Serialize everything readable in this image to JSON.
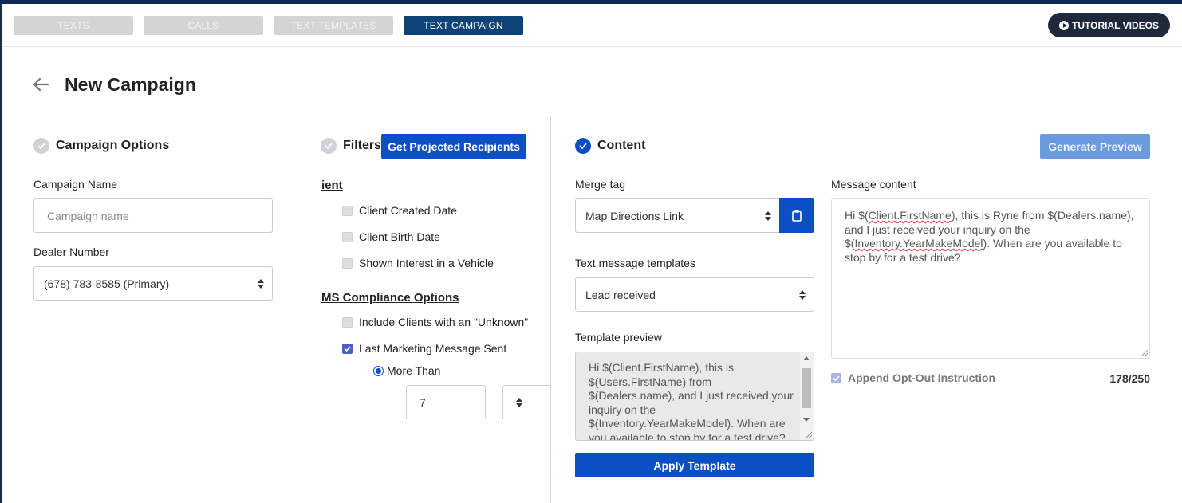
{
  "tabs": [
    {
      "label": "TEXTS",
      "active": false
    },
    {
      "label": "CALLS",
      "active": false
    },
    {
      "label": "TEXT TEMPLATES",
      "active": false
    },
    {
      "label": "TEXT CAMPAIGN",
      "active": true
    }
  ],
  "tutorial_button": {
    "label": "TUTORIAL VIDEOS",
    "icon": "play-icon"
  },
  "page_title": "New Campaign",
  "campaign_options": {
    "heading": "Campaign Options",
    "campaign_name_label": "Campaign Name",
    "campaign_name_placeholder": "Campaign name",
    "campaign_name_value": "",
    "dealer_number_label": "Dealer Number",
    "dealer_number_value": "(678) 783-8585 (Primary)"
  },
  "filters": {
    "heading": "Filters",
    "projected_button": "Get Projected Recipients",
    "client_group_title": "ient",
    "client_filters": [
      {
        "label": "Client Created Date",
        "checked": false
      },
      {
        "label": "Client Birth Date",
        "checked": false
      },
      {
        "label": "Shown Interest in a Vehicle",
        "checked": false
      }
    ],
    "compliance_group_title": "MS Compliance Options",
    "compliance_filters": [
      {
        "label": "Include Clients with an \"Unknown\"",
        "checked": false
      },
      {
        "label": "Last Marketing Message Sent",
        "checked": true
      }
    ],
    "radio_label": "More Than",
    "radio_selected": true,
    "more_than_value": "7"
  },
  "content": {
    "heading": "Content",
    "generate_preview_button": "Generate Preview",
    "merge_tag_label": "Merge tag",
    "merge_tag_value": "Map Directions Link",
    "templates_label": "Text message templates",
    "templates_value": "Lead received",
    "template_preview_label": "Template preview",
    "template_preview_text": "Hi $(Client.FirstName), this is $(Users.FirstName) from $(Dealers.name), and I just received your inquiry on the $(Inventory.YearMakeModel). When are you available to stop by for a test drive?",
    "apply_template_button": "Apply Template",
    "message_content_label": "Message content",
    "message_parts": {
      "p1": "Hi $(",
      "p2": "Client.FirstName",
      "p3": "), this is Ryne from $(Dealers.name), and I just received your inquiry on the $(",
      "p4": "Inventory.YearMakeModel",
      "p5": "). When are you available to stop by for a test drive?"
    },
    "append_opt_out_label": "Append Opt-Out Instruction",
    "append_opt_out_checked": true,
    "char_count": "178/250"
  },
  "colors": {
    "primary": "#0b4fc4",
    "tab_active": "#0f4376",
    "tutorial_bg": "#1e2a3a"
  }
}
